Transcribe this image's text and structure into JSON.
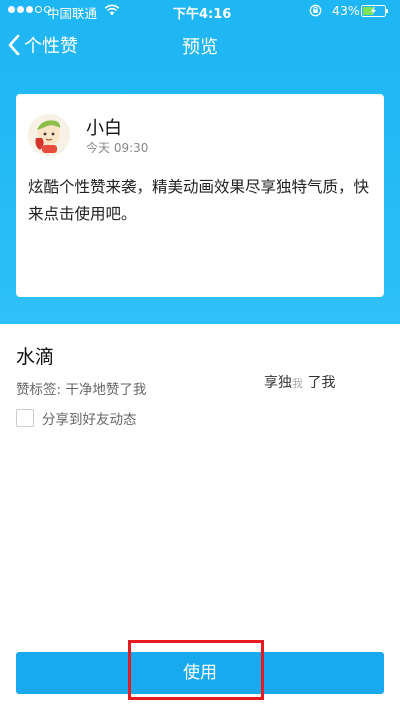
{
  "status_bar": {
    "carrier": "中国联通",
    "time": "下午4:16",
    "battery_percent": "43%",
    "signal_strength": 3,
    "signal_total": 5
  },
  "nav": {
    "back_label": "个性赞",
    "title": "预览"
  },
  "preview_card": {
    "user_name": "小白",
    "timestamp": "今天 09:30",
    "content": "炫酷个性赞来袭，精美动画效果尽享独特气质，快来点击使用吧。"
  },
  "style": {
    "name": "水滴",
    "like_tag": "赞标签: 干净地赞了我",
    "like_preview_main": "享独",
    "like_preview_faded": "我",
    "like_preview_end": "了我"
  },
  "share": {
    "label": "分享到好友动态",
    "checked": false
  },
  "actions": {
    "use_label": "使用"
  },
  "colors": {
    "primary_blue": "#1fb6f4",
    "button_blue": "#19a9ef",
    "highlight_red": "#e8191f"
  }
}
